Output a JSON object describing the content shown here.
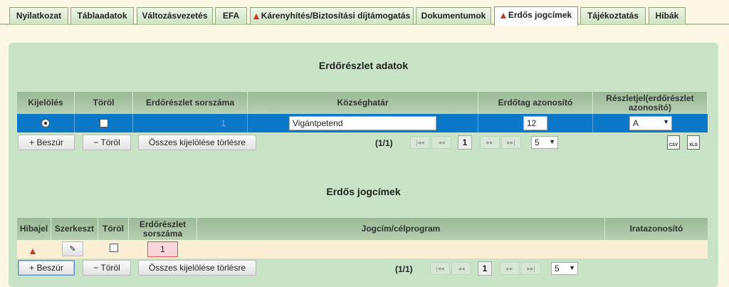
{
  "tabs": [
    {
      "label": "Nyilatkozat",
      "warn": false
    },
    {
      "label": "Táblaadatok",
      "warn": false
    },
    {
      "label": "Változásvezetés",
      "warn": false
    },
    {
      "label": "EFA",
      "warn": false
    },
    {
      "label": "Kárenyhítés/Biztosítási díjtámogatás",
      "warn": true
    },
    {
      "label": "Dokumentumok",
      "warn": false
    },
    {
      "label": "Erdős jogcímek",
      "warn": true,
      "active": true
    },
    {
      "label": "Tájékoztatás",
      "warn": false
    },
    {
      "label": "Hibák",
      "warn": false
    }
  ],
  "section1": {
    "title": "Erdőrészlet adatok",
    "headers": [
      "Kijelölés",
      "Töröl",
      "Erdőrészlet sorszáma",
      "Községhatár",
      "Erdőtag azonosító",
      "Részletjel(erdőrészlet azonosító)"
    ],
    "row": {
      "sorszam": "1",
      "kozseghatar": "Vigántpetend",
      "erdotag": "12",
      "reszletjel": "A"
    },
    "buttons": {
      "insert": "+ Beszúr",
      "delete": "− Töröl",
      "clear": "Összes kijelölése törlésre"
    },
    "pager": {
      "info": "(1/1)",
      "first": "|◂◂",
      "prev": "◂◂",
      "page": "1",
      "next": "▸▸",
      "last": "▸▸|",
      "size": "5"
    },
    "exports": {
      "csv": "CSV",
      "xls": "XLS"
    }
  },
  "section2": {
    "title": "Erdős jogcímek",
    "headers": [
      "Hibajel",
      "Szerkeszt",
      "Töröl",
      "Erdőrészlet sorszáma",
      "Jogcím/célprogram",
      "Iratazonosító"
    ],
    "row": {
      "sorszam": "1"
    },
    "buttons": {
      "insert": "+ Beszúr",
      "delete": "− Töröl",
      "clear": "Összes kijelölése törlésre"
    },
    "pager": {
      "info": "(1/1)",
      "first": "|◂◂",
      "prev": "◂◂",
      "page": "1",
      "next": "▸▸",
      "last": "▸▸|",
      "size": "5"
    }
  },
  "colors": {
    "selected_row": "#0b78c8",
    "panel": "#c9e3c7",
    "header": "#a9c5a4",
    "warning": "#c0392b"
  }
}
